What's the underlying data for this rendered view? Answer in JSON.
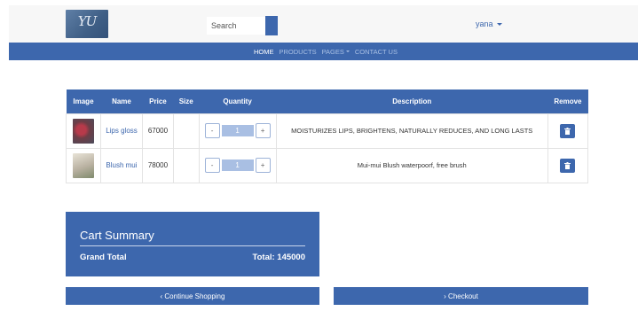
{
  "header": {
    "logo_text": "YU",
    "search": {
      "placeholder": "Search",
      "value": ""
    },
    "user": {
      "name": "yana"
    }
  },
  "nav": {
    "items": [
      {
        "label": "HOME",
        "active": true
      },
      {
        "label": "PRODUCTS",
        "active": false
      },
      {
        "label": "PAGES",
        "active": false,
        "dropdown": true
      },
      {
        "label": "CONTACT US",
        "active": false
      }
    ]
  },
  "cart": {
    "columns": [
      "Image",
      "Name",
      "Price",
      "Size",
      "Quantity",
      "Description",
      "Remove"
    ],
    "rows": [
      {
        "image_icon": "lip-gloss-photo",
        "name": "Lips gloss",
        "price": "67000",
        "size": "",
        "quantity": {
          "minus": "-",
          "value": "1",
          "plus": "+"
        },
        "description": "MOISTURIZES LIPS, BRIGHTENS, NATURALLY REDUCES, AND LONG LASTS",
        "remove_icon": "trash-icon"
      },
      {
        "image_icon": "blush-photo",
        "name": "Blush mui",
        "price": "78000",
        "size": "",
        "quantity": {
          "minus": "-",
          "value": "1",
          "plus": "+"
        },
        "description": "Mui-mui Blush waterpoorf, free brush",
        "remove_icon": "trash-icon"
      }
    ]
  },
  "summary": {
    "title": "Cart Summary",
    "grand_total_label": "Grand Total",
    "total_text": "Total: 145000"
  },
  "actions": {
    "continue_label": "‹ Continue Shopping",
    "checkout_label": "› Checkout"
  },
  "colors": {
    "primary": "#3d67ad",
    "nav_inactive": "#a9c0e4",
    "qty_value_bg": "#a9bfe3",
    "topbar_bg": "#f7f7f7"
  }
}
